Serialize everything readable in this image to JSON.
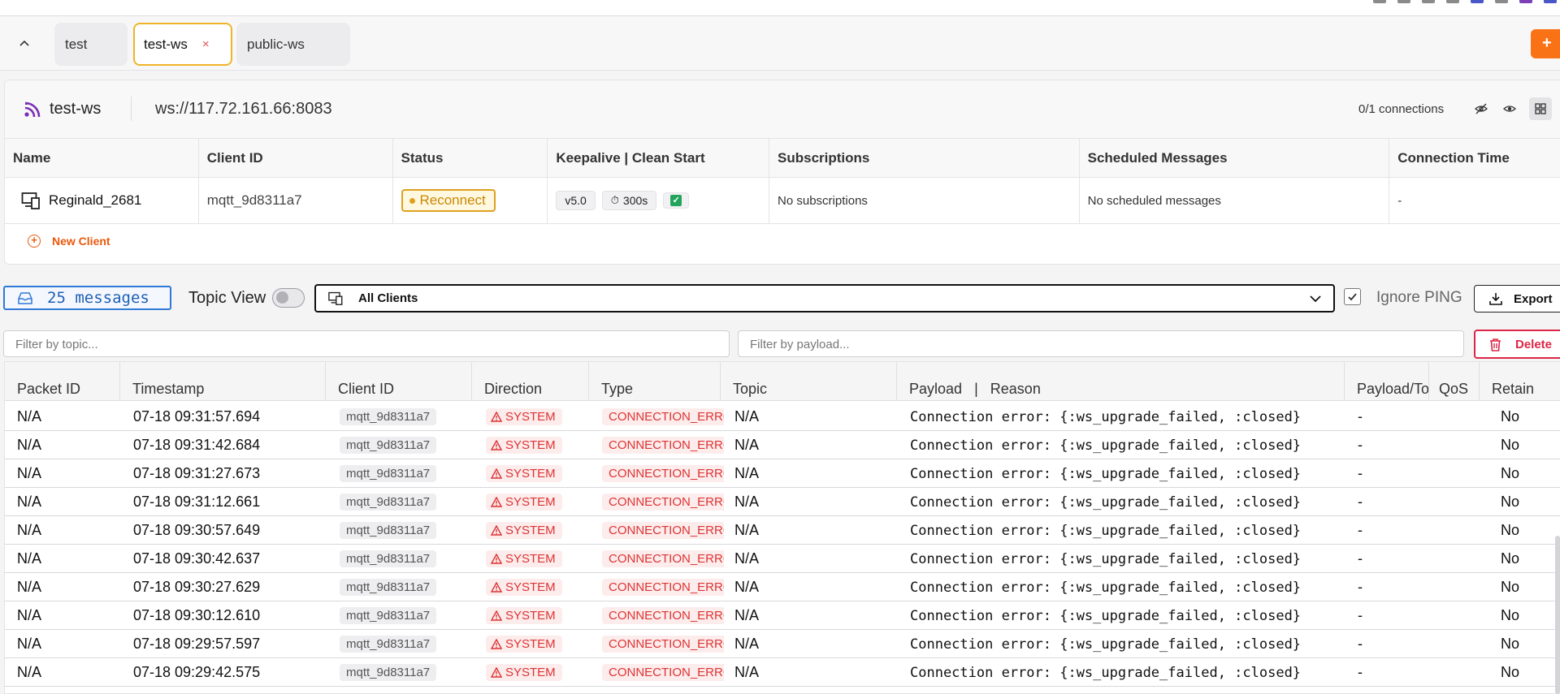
{
  "tabs": [
    {
      "label": "test",
      "active": false
    },
    {
      "label": "test-ws",
      "active": true
    },
    {
      "label": "public-ws",
      "active": false
    }
  ],
  "add_button_label": "+",
  "broker": {
    "name": "test-ws",
    "url": "ws://117.72.161.66:8083",
    "connections": "0/1 connections"
  },
  "clients_table": {
    "headers": [
      "Name",
      "Client ID",
      "Status",
      "Keepalive | Clean Start",
      "Subscriptions",
      "Scheduled Messages",
      "Connection Time"
    ],
    "rows": [
      {
        "name": "Reginald_2681",
        "client_id": "mqtt_9d8311a7",
        "status": "Reconnect",
        "protocol": "v5.0",
        "keepalive": "300s",
        "clean_start": "✓",
        "subscriptions": "No subscriptions",
        "scheduled": "No scheduled messages",
        "connection_time": "-"
      }
    ],
    "new_client_label": "New Client"
  },
  "toolbar": {
    "message_count": "25 messages",
    "topic_view_label": "Topic View",
    "topic_view_on": false,
    "client_filter_value": "All Clients",
    "ignore_ping_label": "Ignore PING",
    "ignore_ping_checked": true,
    "export_label": "Export"
  },
  "filters": {
    "topic_placeholder": "Filter by topic...",
    "payload_placeholder": "Filter by payload...",
    "delete_label": "Delete"
  },
  "messages_table": {
    "headers": {
      "packet_id": "Packet ID",
      "timestamp": "Timestamp",
      "client_id": "Client ID",
      "direction": "Direction",
      "type": "Type",
      "topic": "Topic",
      "payload": "Payload",
      "reason": "Reason",
      "payload_total": "Payload/Total",
      "qos": "QoS",
      "retain": "Retain"
    },
    "rows": [
      {
        "packet_id": "N/A",
        "timestamp": "07-18 09:31:57.694",
        "client_id": "mqtt_9d8311a7",
        "direction": "SYSTEM",
        "type": "CONNECTION_ERROR",
        "topic": "N/A",
        "payload": "Connection error: {:ws_upgrade_failed, :closed}",
        "payload_total": "-",
        "qos": "",
        "retain": "No"
      },
      {
        "packet_id": "N/A",
        "timestamp": "07-18 09:31:42.684",
        "client_id": "mqtt_9d8311a7",
        "direction": "SYSTEM",
        "type": "CONNECTION_ERROR",
        "topic": "N/A",
        "payload": "Connection error: {:ws_upgrade_failed, :closed}",
        "payload_total": "-",
        "qos": "",
        "retain": "No"
      },
      {
        "packet_id": "N/A",
        "timestamp": "07-18 09:31:27.673",
        "client_id": "mqtt_9d8311a7",
        "direction": "SYSTEM",
        "type": "CONNECTION_ERROR",
        "topic": "N/A",
        "payload": "Connection error: {:ws_upgrade_failed, :closed}",
        "payload_total": "-",
        "qos": "",
        "retain": "No"
      },
      {
        "packet_id": "N/A",
        "timestamp": "07-18 09:31:12.661",
        "client_id": "mqtt_9d8311a7",
        "direction": "SYSTEM",
        "type": "CONNECTION_ERROR",
        "topic": "N/A",
        "payload": "Connection error: {:ws_upgrade_failed, :closed}",
        "payload_total": "-",
        "qos": "",
        "retain": "No"
      },
      {
        "packet_id": "N/A",
        "timestamp": "07-18 09:30:57.649",
        "client_id": "mqtt_9d8311a7",
        "direction": "SYSTEM",
        "type": "CONNECTION_ERROR",
        "topic": "N/A",
        "payload": "Connection error: {:ws_upgrade_failed, :closed}",
        "payload_total": "-",
        "qos": "",
        "retain": "No"
      },
      {
        "packet_id": "N/A",
        "timestamp": "07-18 09:30:42.637",
        "client_id": "mqtt_9d8311a7",
        "direction": "SYSTEM",
        "type": "CONNECTION_ERROR",
        "topic": "N/A",
        "payload": "Connection error: {:ws_upgrade_failed, :closed}",
        "payload_total": "-",
        "qos": "",
        "retain": "No"
      },
      {
        "packet_id": "N/A",
        "timestamp": "07-18 09:30:27.629",
        "client_id": "mqtt_9d8311a7",
        "direction": "SYSTEM",
        "type": "CONNECTION_ERROR",
        "topic": "N/A",
        "payload": "Connection error: {:ws_upgrade_failed, :closed}",
        "payload_total": "-",
        "qos": "",
        "retain": "No"
      },
      {
        "packet_id": "N/A",
        "timestamp": "07-18 09:30:12.610",
        "client_id": "mqtt_9d8311a7",
        "direction": "SYSTEM",
        "type": "CONNECTION_ERROR",
        "topic": "N/A",
        "payload": "Connection error: {:ws_upgrade_failed, :closed}",
        "payload_total": "-",
        "qos": "",
        "retain": "No"
      },
      {
        "packet_id": "N/A",
        "timestamp": "07-18 09:29:57.597",
        "client_id": "mqtt_9d8311a7",
        "direction": "SYSTEM",
        "type": "CONNECTION_ERROR",
        "topic": "N/A",
        "payload": "Connection error: {:ws_upgrade_failed, :closed}",
        "payload_total": "-",
        "qos": "",
        "retain": "No"
      },
      {
        "packet_id": "N/A",
        "timestamp": "07-18 09:29:42.575",
        "client_id": "mqtt_9d8311a7",
        "direction": "SYSTEM",
        "type": "CONNECTION_ERROR",
        "topic": "N/A",
        "payload": "Connection error: {:ws_upgrade_failed, :closed}",
        "payload_total": "-",
        "qos": "",
        "retain": "No"
      }
    ]
  },
  "colors": {
    "accent": "#f97316",
    "active_tab_border": "#f0b429",
    "reconnect": "#e0a01d",
    "system_red": "#dd3333",
    "message_count_blue": "#2f78d6",
    "delete_red": "#dc2646",
    "protocol_icon": "#7b2fb5"
  }
}
